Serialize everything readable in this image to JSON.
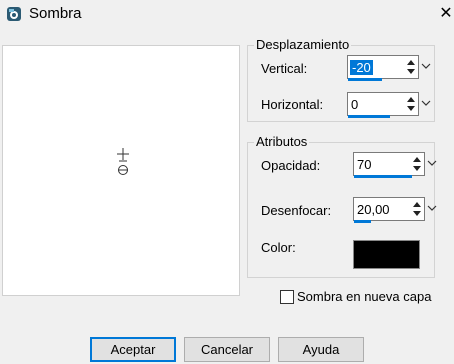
{
  "window": {
    "title": "Sombra",
    "close_glyph": "✕"
  },
  "offset_group": {
    "title": "Desplazamiento",
    "vertical": {
      "label": "Vertical:",
      "value": "-20"
    },
    "horizontal": {
      "label": "Horizontal:",
      "value": "0"
    }
  },
  "attributes_group": {
    "title": "Atributos",
    "opacity": {
      "label": "Opacidad:",
      "value": "70"
    },
    "blur": {
      "label": "Desenfocar:",
      "value": "20,00"
    },
    "color": {
      "label": "Color:",
      "swatch": "#000000"
    }
  },
  "new_layer": {
    "label": "Sombra en nueva capa",
    "checked": false
  },
  "buttons": {
    "ok": "Aceptar",
    "cancel": "Cancelar",
    "help": "Ayuda"
  },
  "colors": {
    "accent": "#0078d7",
    "background": "#f0f0f0"
  },
  "icons": {
    "app": "paint-app-icon",
    "preview": "shadow-preview-crosshair-icon"
  }
}
